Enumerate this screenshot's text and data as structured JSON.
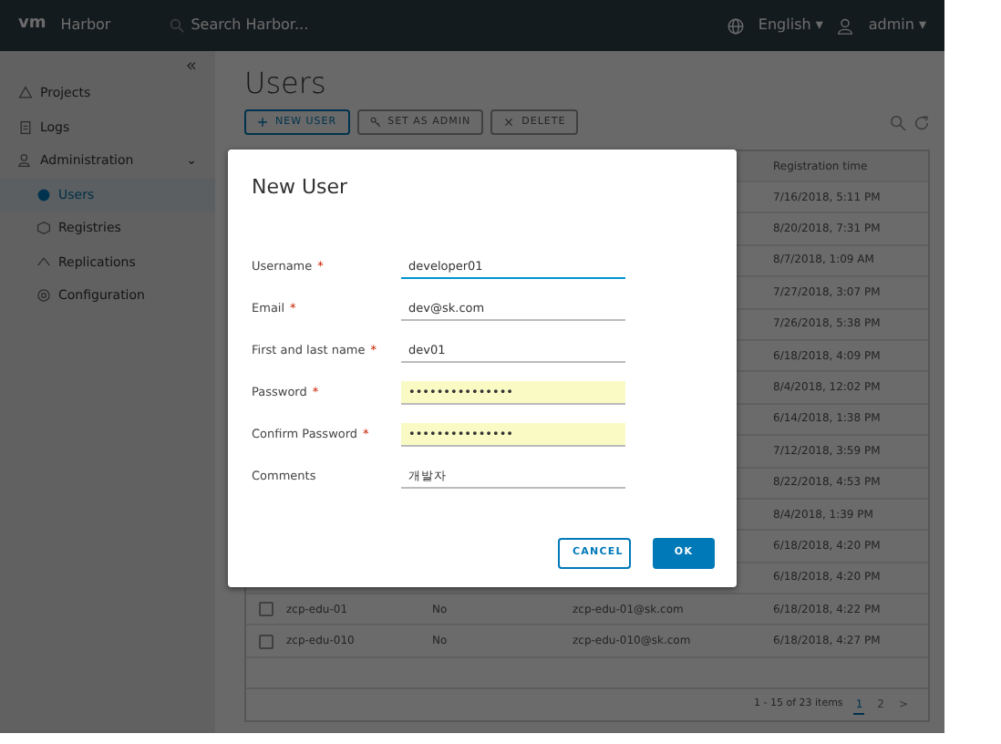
{
  "header": {
    "logo": "vm",
    "product": "Harbor",
    "search_placeholder": "Search Harbor...",
    "language": "English",
    "language_caret": "▾",
    "user": "admin",
    "user_caret": "▾"
  },
  "sidebar": {
    "collapse": "«",
    "items": [
      {
        "label": "Projects",
        "kind": "projects",
        "selected": false
      },
      {
        "label": "Logs",
        "kind": "logs",
        "selected": false
      },
      {
        "label": "Administration",
        "kind": "admin",
        "selected": false,
        "expanded": true,
        "toggle": "⌄",
        "children": [
          {
            "label": "Users",
            "kind": "users",
            "selected": true
          },
          {
            "label": "Registries",
            "kind": "registries",
            "selected": false
          },
          {
            "label": "Replications",
            "kind": "replications",
            "selected": false
          },
          {
            "label": "Configuration",
            "kind": "configuration",
            "selected": false
          }
        ]
      }
    ]
  },
  "main": {
    "title": "Users",
    "toolbar": [
      {
        "label": "NEW USER",
        "kind": "add",
        "disabled": false
      },
      {
        "label": "SET AS ADMIN",
        "kind": "admin",
        "disabled": true
      },
      {
        "label": "DELETE",
        "kind": "delete",
        "disabled": true
      }
    ],
    "table": {
      "registration_time_header": "Registration time",
      "rows": [
        {
          "registration_time": "7/16/2018, 5:11 PM"
        },
        {
          "registration_time": "8/20/2018, 7:31 PM"
        },
        {
          "registration_time": "8/7/2018, 1:09 AM"
        },
        {
          "registration_time": "7/27/2018, 3:07 PM"
        },
        {
          "registration_time": "7/26/2018, 5:38 PM"
        },
        {
          "registration_time": "6/18/2018, 4:09 PM"
        },
        {
          "registration_time": "8/4/2018, 12:02 PM"
        },
        {
          "registration_time": "6/14/2018, 1:38 PM"
        },
        {
          "registration_time": "7/12/2018, 3:59 PM"
        },
        {
          "registration_time": "8/22/2018, 4:53 PM"
        },
        {
          "registration_time": "8/4/2018, 1:39 PM"
        },
        {
          "registration_time": "6/18/2018, 4:20 PM"
        },
        {
          "registration_time": "6/18/2018, 4:20 PM"
        },
        {
          "checked": false,
          "username": "zcp-edu-01",
          "admin": "No",
          "email": "zcp-edu-01@sk.com",
          "registration_time": "6/18/2018, 4:22 PM"
        },
        {
          "checked": false,
          "username": "zcp-edu-010",
          "admin": "No",
          "email": "zcp-edu-010@sk.com",
          "registration_time": "6/18/2018, 4:27 PM"
        }
      ],
      "footer": {
        "range": "1 - 15 of 23 items",
        "pages": [
          {
            "label": "1",
            "selected": true
          },
          {
            "label": "2",
            "selected": false
          }
        ],
        "next": ">"
      }
    }
  },
  "dialog": {
    "title": "New User",
    "fields": [
      {
        "label": "Username",
        "required_mark": "*",
        "value": "developer01",
        "focused": true,
        "autofilled": false
      },
      {
        "label": "Email",
        "required_mark": "*",
        "value": "dev@sk.com",
        "focused": false,
        "autofilled": false
      },
      {
        "label": "First and last name",
        "required_mark": "*",
        "value": "dev01",
        "focused": false,
        "autofilled": false
      },
      {
        "label": "Password",
        "required_mark": "*",
        "value": "•••••••••••••••",
        "focused": false,
        "autofilled": true
      },
      {
        "label": "Confirm Password",
        "required_mark": "*",
        "value": "•••••••••••••••",
        "focused": false,
        "autofilled": true
      },
      {
        "label": "Comments",
        "value": "개발자",
        "focused": false,
        "autofilled": false
      }
    ],
    "buttons": [
      {
        "label": "CANCEL",
        "kind": "secondary"
      },
      {
        "label": "OK",
        "kind": "primary"
      }
    ]
  }
}
